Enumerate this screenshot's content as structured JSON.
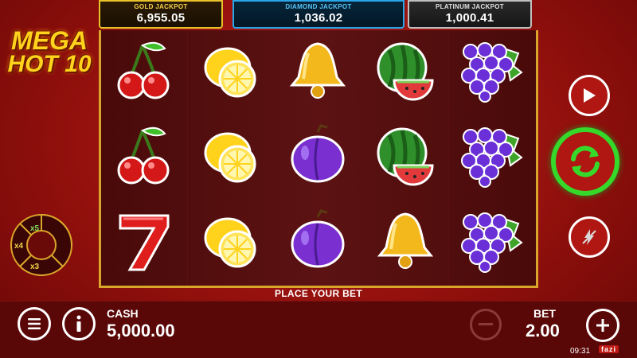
{
  "jackpots": {
    "gold": {
      "label": "GOLD JACKPOT",
      "value": "6,955.05"
    },
    "diamond": {
      "label": "DIAMOND JACKPOT",
      "value": "1,036.02"
    },
    "platinum": {
      "label": "PLATINUM JACKPOT",
      "value": "1,000.41"
    }
  },
  "logo": {
    "line1": "MEGA",
    "line2": "HOT 10"
  },
  "reels": [
    [
      "cherry",
      "lemon",
      "bell",
      "watermelon",
      "grapes"
    ],
    [
      "cherry",
      "lemon",
      "plum",
      "watermelon",
      "grapes"
    ],
    [
      "seven",
      "lemon",
      "plum",
      "bell",
      "grapes"
    ]
  ],
  "status_message": "PLACE YOUR BET",
  "multipliers": {
    "top": "x5",
    "left": "x4",
    "bottom": "x3"
  },
  "cash": {
    "label": "CASH",
    "value": "5,000.00"
  },
  "bet": {
    "label": "BET",
    "value": "2.00"
  },
  "clock": "09:31",
  "brand": "fazi",
  "icons": {
    "menu": "menu-icon",
    "info": "info-icon",
    "play": "play-icon",
    "spin": "spin-icon",
    "turbo": "turbo-icon",
    "minus": "minus-icon",
    "plus": "plus-icon"
  },
  "colors": {
    "gold": "#e8c22a",
    "diamond": "#2aa6e8",
    "platinum": "#bfbfbf",
    "spin_ring": "#36d92a",
    "background": "#a8150f"
  }
}
